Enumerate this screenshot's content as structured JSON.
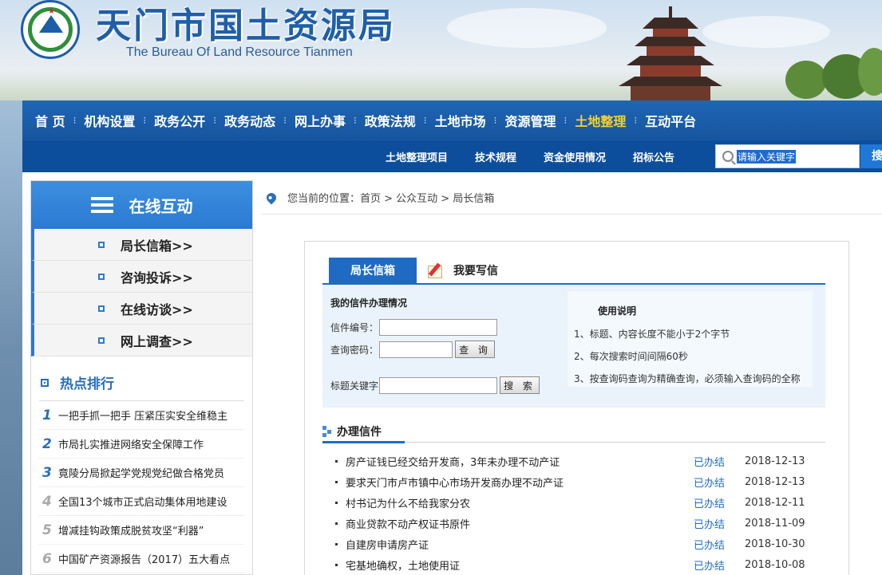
{
  "header": {
    "title_cn": "天门市国土资源局",
    "title_en": "The Bureau Of Land Resource Tianmen"
  },
  "main_nav": [
    {
      "label": "首 页",
      "active": false
    },
    {
      "label": "机构设置",
      "active": false
    },
    {
      "label": "政务公开",
      "active": false
    },
    {
      "label": "政务动态",
      "active": false
    },
    {
      "label": "网上办事",
      "active": false
    },
    {
      "label": "政策法规",
      "active": false
    },
    {
      "label": "土地市场",
      "active": false
    },
    {
      "label": "资源管理",
      "active": false
    },
    {
      "label": "土地整理",
      "active": true
    },
    {
      "label": "互动平台",
      "active": false
    }
  ],
  "sub_nav": [
    "土地整理项目",
    "技术规程",
    "资金使用情况",
    "招标公告"
  ],
  "search": {
    "placeholder": "请输入关键字",
    "button": "搜"
  },
  "sidebar": {
    "title": "在线互动",
    "items": [
      "局长信箱>>",
      "咨询投诉>>",
      "在线访谈>>",
      "网上调查>>"
    ],
    "hot_title": "热点排行",
    "hot": [
      {
        "rank": "1",
        "text": "一把手抓一把手 压紧压实安全维稳主"
      },
      {
        "rank": "2",
        "text": "市局扎实推进网络安全保障工作"
      },
      {
        "rank": "3",
        "text": "竟陵分局掀起学党规党纪做合格党员"
      },
      {
        "rank": "4",
        "text": "全国13个城市正式启动集体用地建设"
      },
      {
        "rank": "5",
        "text": "增减挂钩政策成脱贫攻坚“利器”"
      },
      {
        "rank": "6",
        "text": "中国矿产资源报告（2017）五大看点"
      }
    ]
  },
  "breadcrumb": "您当前的位置：首页 > 公众互动 > 局长信箱",
  "panel": {
    "tab_active": "局长信箱",
    "tab_write": "我要写信",
    "form_heading": "我的信件办理情况",
    "letter_no_label": "信件编号：",
    "password_label": "查询密码：",
    "query_button": "查 询",
    "keyword_label": "标题关键字",
    "search_button": "搜 索",
    "help_title": "使用说明",
    "help": [
      "1、标题、内容长度不能小于2个字节",
      "2、每次搜索时间间隔60秒",
      "3、按查询码查询为精确查询，必须输入查询码的全称"
    ],
    "list_title": "办理信件",
    "letters": [
      {
        "title": "房产证钱已经交给开发商，3年未办理不动产证",
        "status": "已办结",
        "date": "2018-12-13"
      },
      {
        "title": "要求天门市卢市镇中心市场开发商办理不动产证",
        "status": "已办结",
        "date": "2018-12-13"
      },
      {
        "title": "村书记为什么不给我家分农",
        "status": "已办结",
        "date": "2018-12-11"
      },
      {
        "title": "商业贷款不动产权证书原件",
        "status": "已办结",
        "date": "2018-11-09"
      },
      {
        "title": "自建房申请房产证",
        "status": "已办结",
        "date": "2018-10-30"
      },
      {
        "title": "宅基地确权，土地使用证",
        "status": "已办结",
        "date": "2018-10-08"
      }
    ]
  },
  "colors": {
    "nav_blue": "#1f66b4",
    "active_yellow": "#f7d02c",
    "status_blue": "#1e6cc4"
  }
}
